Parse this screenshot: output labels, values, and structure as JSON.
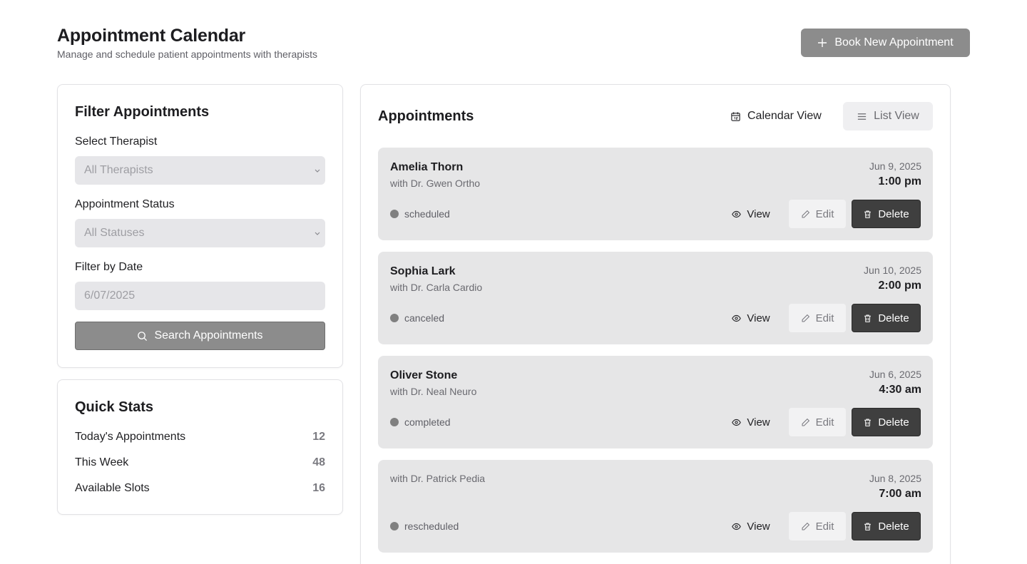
{
  "header": {
    "title": "Appointment Calendar",
    "subtitle": "Manage and schedule patient appointments with therapists",
    "book_button": "Book New Appointment"
  },
  "filters": {
    "title": "Filter Appointments",
    "therapist_label": "Select Therapist",
    "therapist_value": "All Therapists",
    "status_label": "Appointment Status",
    "status_value": "All Statuses",
    "date_label": "Filter by Date",
    "date_value": "6/07/2025",
    "search_button": "Search Appointments"
  },
  "stats": {
    "title": "Quick Stats",
    "rows": [
      {
        "label": "Today's Appointments",
        "value": "12"
      },
      {
        "label": "This Week",
        "value": "48"
      },
      {
        "label": "Available Slots",
        "value": "16"
      }
    ]
  },
  "appointments": {
    "title": "Appointments",
    "calendar_view": "Calendar View",
    "list_view": "List View",
    "actions": {
      "view": "View",
      "edit": "Edit",
      "delete": "Delete"
    },
    "items": [
      {
        "patient": "Amelia Thorn",
        "therapist": "with Dr. Gwen Ortho",
        "date": "Jun 9, 2025",
        "time": "1:00 pm",
        "status": "scheduled"
      },
      {
        "patient": "Sophia Lark",
        "therapist": "with Dr. Carla Cardio",
        "date": "Jun 10, 2025",
        "time": "2:00 pm",
        "status": "canceled"
      },
      {
        "patient": "Oliver Stone",
        "therapist": "with Dr. Neal Neuro",
        "date": "Jun 6, 2025",
        "time": "4:30 am",
        "status": "completed"
      },
      {
        "patient": "",
        "therapist": "with Dr. Patrick Pedia",
        "date": "Jun 8, 2025",
        "time": "7:00 am",
        "status": "rescheduled"
      }
    ]
  },
  "icons": {
    "book": "plus-icon",
    "search": "search-icon",
    "calendar": "calendar-icon",
    "list": "list-icon",
    "view": "eye-icon",
    "edit": "pencil-icon",
    "delete": "trash-icon",
    "dropdown": "chevron-down-icon"
  },
  "colors": {
    "primary_button": "#8c8c8c",
    "delete_button": "#3f3f3f",
    "card_background": "#e6e6e7",
    "status_dot": "#808080"
  }
}
